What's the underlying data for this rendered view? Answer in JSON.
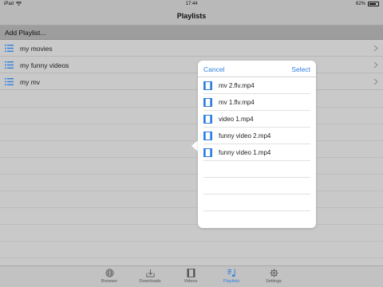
{
  "status_bar": {
    "carrier": "iPad",
    "time": "17:44",
    "battery": "62%"
  },
  "nav": {
    "title": "Playlists"
  },
  "add_row": {
    "label": "Add Playlist..."
  },
  "playlists": [
    {
      "label": "my movies"
    },
    {
      "label": "my funny videos"
    },
    {
      "label": "my mv"
    }
  ],
  "popover": {
    "cancel_label": "Cancel",
    "select_label": "Select",
    "files": [
      {
        "name": "mv 2.flv.mp4"
      },
      {
        "name": "mv 1.flv.mp4"
      },
      {
        "name": "video 1.mp4"
      },
      {
        "name": "funny video 2.mp4"
      },
      {
        "name": "funny video 1.mp4"
      }
    ]
  },
  "tabs": [
    {
      "label": "Browser",
      "icon": "globe-icon",
      "active": false
    },
    {
      "label": "Downloads",
      "icon": "download-tray-icon",
      "active": false
    },
    {
      "label": "Videos",
      "icon": "film-icon",
      "active": false
    },
    {
      "label": "Playlists",
      "icon": "music-note-icon",
      "active": true
    },
    {
      "label": "Settings",
      "icon": "gear-icon",
      "active": false
    }
  ],
  "colors": {
    "accent": "#2f7fe0",
    "background": "#c9c9c9",
    "header_row": "#9d9d9d"
  }
}
